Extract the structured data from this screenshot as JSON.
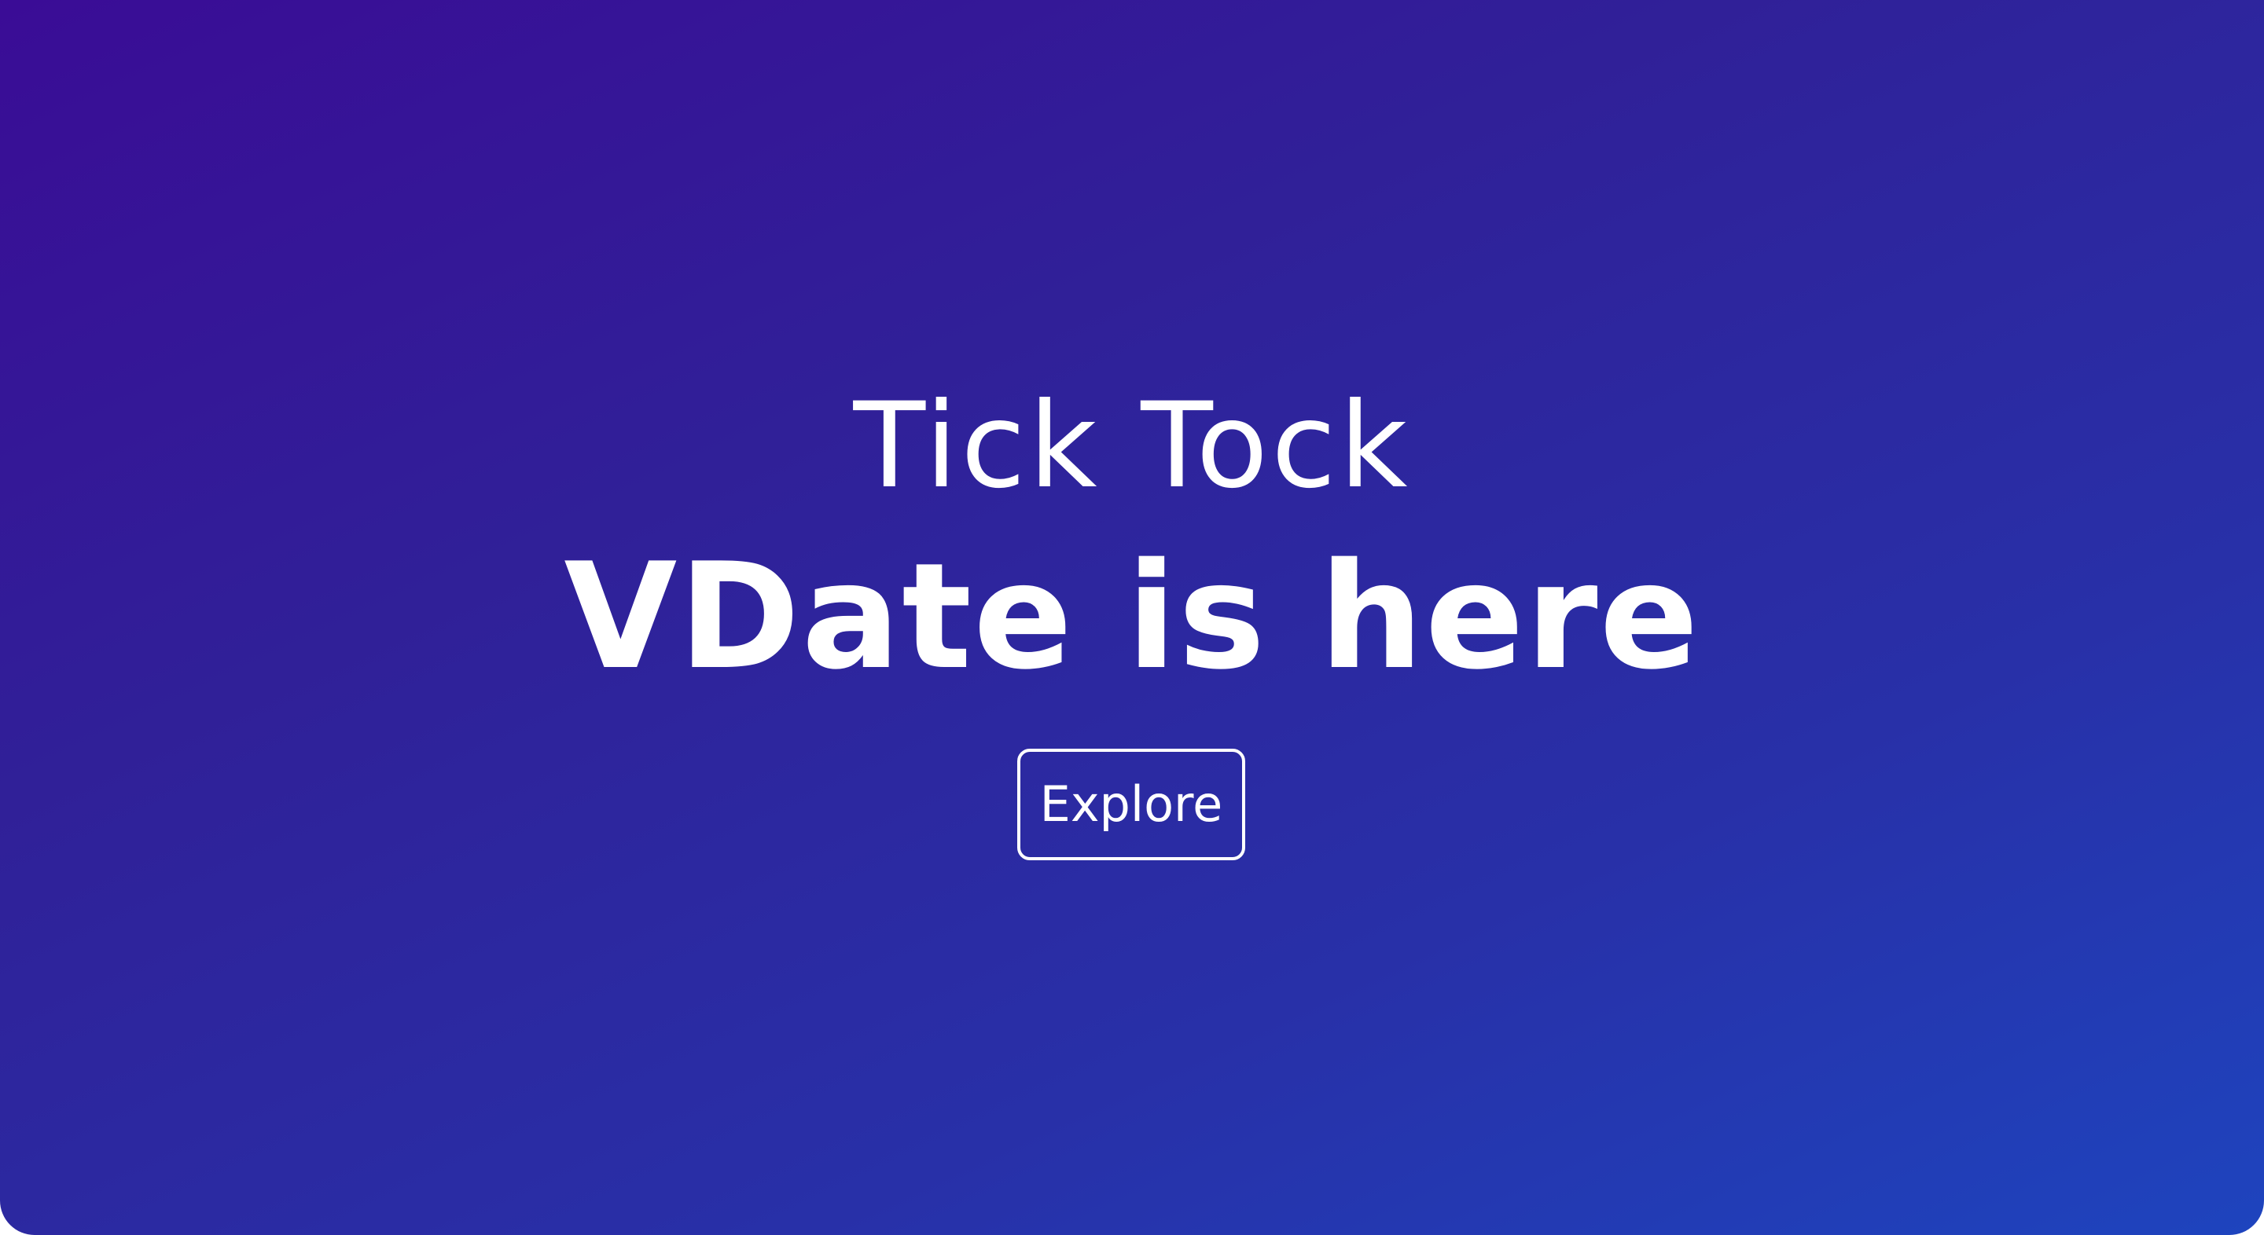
{
  "hero": {
    "eyebrow": "Tick Tock",
    "headline": "VDate is here",
    "cta_label": "Explore"
  },
  "colors": {
    "gradient_start": "#3a0c96",
    "gradient_end": "#1e44be",
    "text": "#ffffff"
  }
}
